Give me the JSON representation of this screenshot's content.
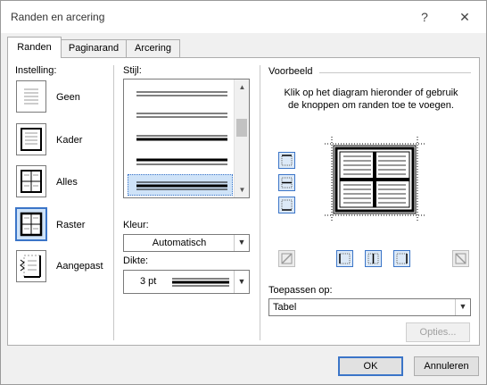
{
  "window": {
    "title": "Randen en arcering",
    "help_glyph": "?",
    "close_glyph": "✕"
  },
  "tabs": [
    {
      "label": "Randen",
      "active": true
    },
    {
      "label": "Paginarand",
      "active": false
    },
    {
      "label": "Arcering",
      "active": false
    }
  ],
  "setting": {
    "label": "Instelling:",
    "options": [
      {
        "label": "Geen",
        "icon": "setting-none-icon",
        "selected": false
      },
      {
        "label": "Kader",
        "icon": "setting-box-icon",
        "selected": false
      },
      {
        "label": "Alles",
        "icon": "setting-all-icon",
        "selected": false
      },
      {
        "label": "Raster",
        "icon": "setting-grid-icon",
        "selected": true
      },
      {
        "label": "Aangepast",
        "icon": "setting-custom-icon",
        "selected": false
      }
    ]
  },
  "style": {
    "label": "Stijl:",
    "items": [
      "double-line",
      "double-line",
      "thick-thin",
      "thick-thin",
      "thick-thin-selected"
    ]
  },
  "color": {
    "label": "Kleur:",
    "value": "Automatisch"
  },
  "width": {
    "label": "Dikte:",
    "value": "3 pt"
  },
  "preview": {
    "label": "Voorbeeld",
    "description": "Klik op het diagram hieronder of gebruik de knoppen om randen toe te voegen."
  },
  "apply_to": {
    "label": "Toepassen op:",
    "value": "Tabel"
  },
  "buttons": {
    "options": "Opties...",
    "ok": "OK",
    "cancel": "Annuleren"
  },
  "colors": {
    "accent": "#3b75c8",
    "selected_bg": "#cfe3f8"
  }
}
